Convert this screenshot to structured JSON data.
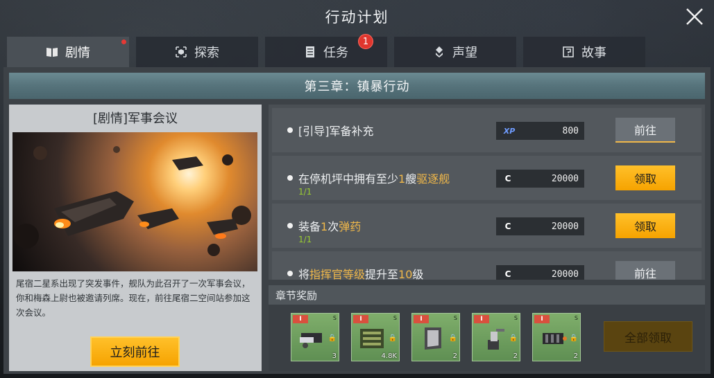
{
  "window": {
    "title": "行动计划"
  },
  "tabs": [
    {
      "label": "剧情",
      "icon": "book-icon",
      "active": true,
      "red_dot": true
    },
    {
      "label": "探索",
      "icon": "explore-icon"
    },
    {
      "label": "任务",
      "icon": "task-list-icon",
      "badge": "1"
    },
    {
      "label": "声望",
      "icon": "reputation-icon"
    },
    {
      "label": "故事",
      "icon": "story-icon"
    }
  ],
  "chapter": {
    "title": "第三章：镇暴行动"
  },
  "story": {
    "title": "[剧情]军事会议",
    "description": "尾宿二星系出现了突发事件，舰队为此召开了一次军事会议，你和梅森上尉也被邀请列席。现在，前往尾宿二空间站参加这次会议。",
    "button_label": "立刻前往"
  },
  "tasks": [
    {
      "text_parts": [
        "[引导]军备补充"
      ],
      "progress": "",
      "reward_icon": "xp-icon",
      "reward_label": "XP",
      "reward_value": "800",
      "action_label": "前往",
      "action_type": "goto"
    },
    {
      "text_parts": [
        "在停机坪中拥有至少",
        "1",
        "艘",
        "驱逐舰"
      ],
      "progress": "1/1",
      "reward_icon": "credit-icon",
      "reward_label": "C",
      "reward_value": "20000",
      "action_label": "领取",
      "action_type": "claim"
    },
    {
      "text_parts": [
        "装备",
        "1",
        "次",
        "弹药"
      ],
      "progress": "1/1",
      "reward_icon": "credit-icon",
      "reward_label": "C",
      "reward_value": "20000",
      "action_label": "领取",
      "action_type": "claim"
    },
    {
      "text_parts": [
        "将",
        "指挥官等级",
        "提升至",
        "10",
        "级"
      ],
      "progress": "",
      "reward_icon": "credit-icon",
      "reward_label": "C",
      "reward_value": "20000",
      "action_label": "前往",
      "action_type": "goto"
    }
  ],
  "chapter_rewards": {
    "title": "章节奖励",
    "items": [
      {
        "tier": "I",
        "grade": "S",
        "qty": "3"
      },
      {
        "tier": "I",
        "grade": "S",
        "qty": "4.8K"
      },
      {
        "tier": "I",
        "grade": "S",
        "qty": "2"
      },
      {
        "tier": "I",
        "grade": "S",
        "qty": "2"
      },
      {
        "tier": "I",
        "grade": "S",
        "qty": "2"
      }
    ],
    "claim_all_label": "全部领取"
  }
}
